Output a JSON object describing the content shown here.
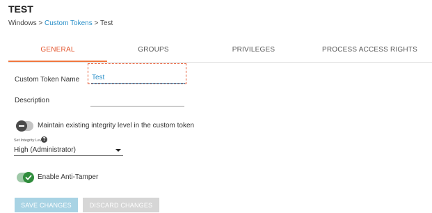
{
  "page": {
    "title": "TEST"
  },
  "breadcrumb": {
    "root": "Windows",
    "sep1": " > ",
    "parent": "Custom Tokens",
    "sep2": " > ",
    "current": "Test"
  },
  "tabs": [
    {
      "label": "GENERAL",
      "active": true
    },
    {
      "label": "GROUPS",
      "active": false
    },
    {
      "label": "PRIVILEGES",
      "active": false
    },
    {
      "label": "PROCESS ACCESS RIGHTS",
      "active": false
    }
  ],
  "form": {
    "token_name_label": "Custom Token Name",
    "token_name_value": "Test",
    "description_label": "Description",
    "description_value": "",
    "maintain_label": "Maintain existing integrity level in the custom token",
    "maintain_on": false,
    "integrity_label": "Set Integrity Level",
    "integrity_value": "High (Administrator)",
    "anti_tamper_label": "Enable Anti-Tamper",
    "anti_tamper_on": true
  },
  "actions": {
    "save": "SAVE CHANGES",
    "discard": "DISCARD CHANGES"
  },
  "colors": {
    "accent": "#f0773f",
    "link": "#2a8fc8",
    "toggle_on": "#2f8c3c"
  },
  "icons": {
    "help": "help-icon",
    "dropdown": "caret-down-icon",
    "check": "check-icon"
  }
}
